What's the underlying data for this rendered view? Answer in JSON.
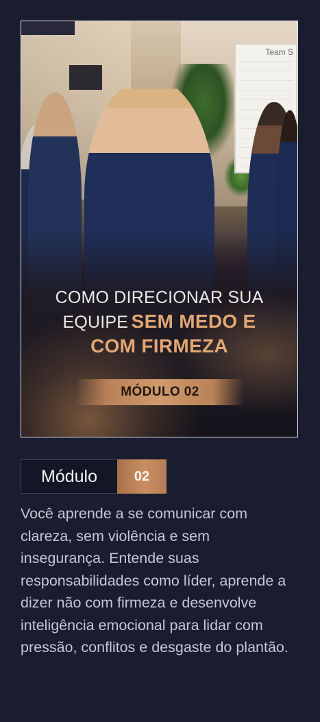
{
  "hero": {
    "board_title": "Team S",
    "headline_line1": "COMO DIRECIONAR SUA",
    "headline_line2a": "EQUIPE",
    "headline_line2b": "SEM MEDO E",
    "headline_line3": "COM FIRMEZA",
    "module_banner": "MÓDULO 02"
  },
  "module": {
    "label": "Módulo",
    "number": "02"
  },
  "description": "Você aprende a se comunicar com clareza, sem violência e sem insegurança. Entende suas responsabilidades como líder, aprende a dizer não com firmeza e desenvolve inteligência emocional para lidar com pressão, conflitos e desgaste do plantão.",
  "colors": {
    "background": "#1a1d30",
    "accent_gold": "#e3a774",
    "module_badge": "#c98f62",
    "text_light": "#c5c7d2"
  }
}
